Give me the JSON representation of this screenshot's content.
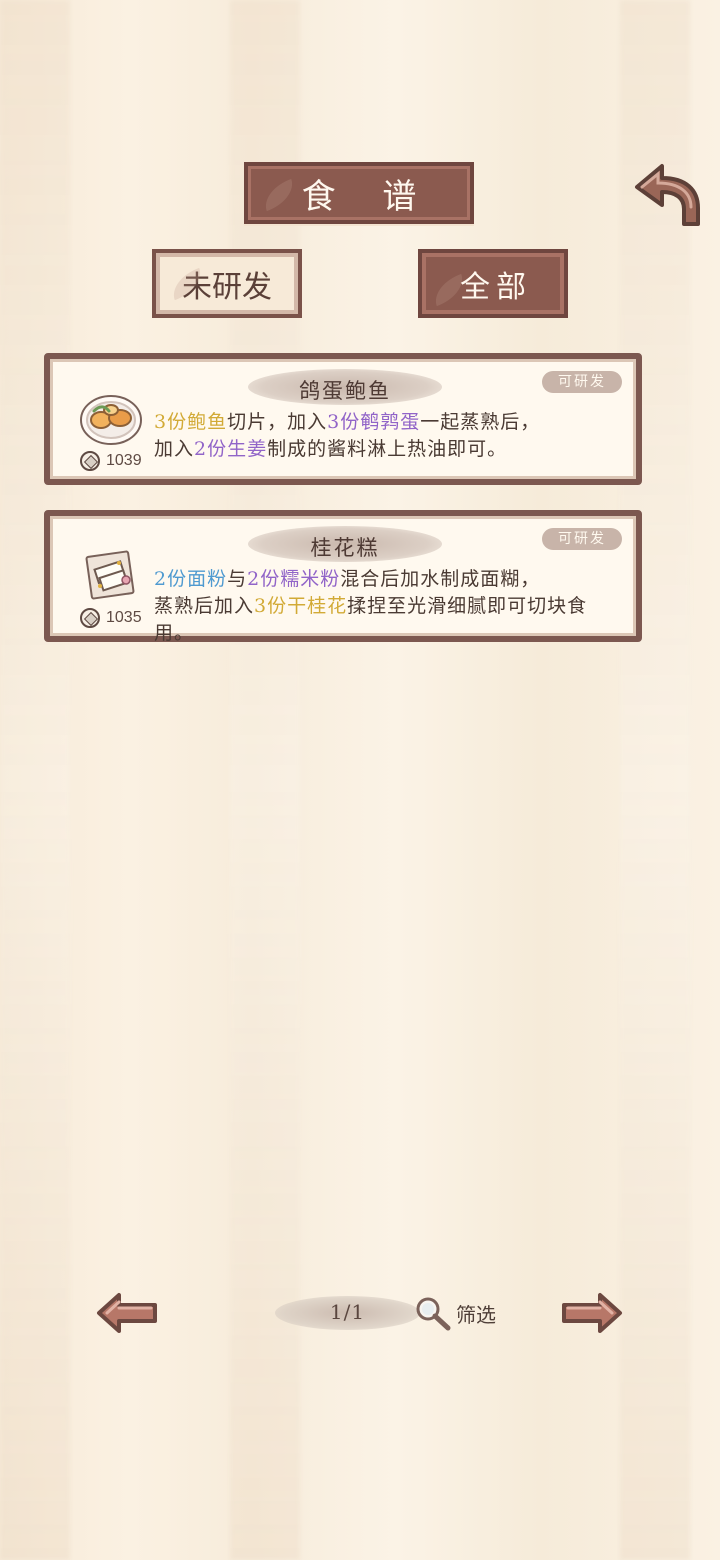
{
  "screen": {
    "title": "食 谱"
  },
  "tabs": [
    {
      "label": "未研发"
    },
    {
      "label": "全部"
    }
  ],
  "recipes": [
    {
      "name": "鸽蛋鲍鱼",
      "status": "可研发",
      "cost": "1039",
      "description": {
        "parts": [
          "3份鲍鱼",
          "切片，加入",
          "3份鹌鹑蛋",
          "一起蒸熟后，",
          "加入",
          "2份生姜",
          "制成的酱料淋上热油即可。"
        ]
      }
    },
    {
      "name": "桂花糕",
      "status": "可研发",
      "cost": "1035",
      "description": {
        "parts": [
          "2份面粉",
          "与",
          "2份糯米粉",
          "混合后加水制成面糊，",
          "蒸熟后加入",
          "3份干桂花",
          "揉捏至光滑细腻即可切块食用。"
        ]
      }
    }
  ],
  "pagination": {
    "page": "1/1",
    "filter_label": "筛选"
  },
  "icons": {
    "back": "back-arrow-icon",
    "previous": "left-arrow-icon",
    "next": "right-arrow-icon",
    "search": "magnifier-icon",
    "coin": "coin-icon"
  },
  "colors": {
    "button_brown": "#8b5a4f",
    "border_brown": "#7c5850",
    "gold_ingredient": "#d2aa36",
    "purple_ingredient": "#9164c8",
    "blue_ingredient": "#4f9ad0"
  }
}
